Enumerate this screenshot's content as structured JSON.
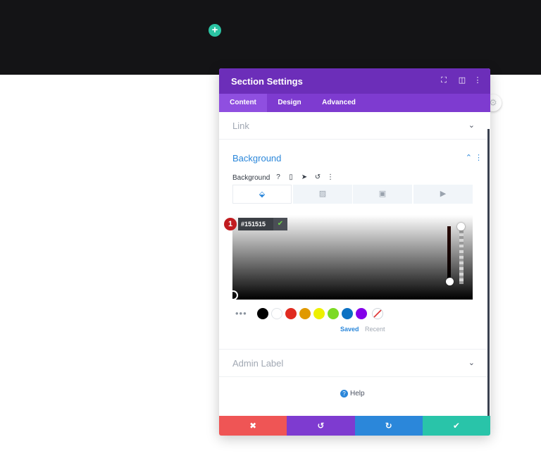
{
  "canvas": {
    "add_section_icon": "plus-icon",
    "add_symbol": "+",
    "side_handle_icon": "gear-icon",
    "side_handle_symbol": "⚙"
  },
  "modal": {
    "title": "Section Settings",
    "header_icons": [
      {
        "name": "expand-icon",
        "glyph": "⛶"
      },
      {
        "name": "split-view-icon",
        "glyph": "◫"
      },
      {
        "name": "more-vertical-icon",
        "glyph": "⋮"
      }
    ],
    "tabs": [
      {
        "label": "Content",
        "active": true
      },
      {
        "label": "Design",
        "active": false
      },
      {
        "label": "Advanced",
        "active": false
      }
    ]
  },
  "sections": {
    "link": {
      "title": "Link",
      "chevron": "⌄"
    },
    "background": {
      "title": "Background",
      "chevron": "⌃",
      "dots": "⋮",
      "field_label": "Background",
      "field_icons": [
        {
          "name": "help-icon",
          "glyph": "?"
        },
        {
          "name": "mobile-icon",
          "glyph": "▯"
        },
        {
          "name": "hover-cursor-icon",
          "glyph": "➤"
        },
        {
          "name": "reset-icon",
          "glyph": "↺"
        },
        {
          "name": "more-icon",
          "glyph": "⋮"
        }
      ],
      "type_tabs": [
        {
          "name": "color-fill-icon",
          "glyph": "⬙",
          "active": true
        },
        {
          "name": "gradient-icon",
          "glyph": "▨",
          "active": false
        },
        {
          "name": "image-icon",
          "glyph": "▣",
          "active": false
        },
        {
          "name": "video-icon",
          "glyph": "▶",
          "active": false
        }
      ],
      "color_hex": "#151515",
      "confirm_glyph": "✔",
      "marker_number": "1",
      "swatches": [
        "#000000",
        "#ffffff",
        "#e02b20",
        "#e09900",
        "#edf000",
        "#7cda24",
        "#0c71c3",
        "#8300e9"
      ],
      "more_glyph": "•••",
      "saved_label": "Saved",
      "recent_label": "Recent"
    },
    "admin_label": {
      "title": "Admin Label",
      "chevron": "⌄"
    }
  },
  "help": {
    "label": "Help",
    "glyph": "?"
  },
  "footer": {
    "buttons": [
      {
        "name": "cancel-button",
        "glyph": "✖",
        "color": "#ef5555"
      },
      {
        "name": "undo-button",
        "glyph": "↺",
        "color": "#7e3bd0"
      },
      {
        "name": "redo-button",
        "glyph": "↻",
        "color": "#2b87da"
      },
      {
        "name": "save-button",
        "glyph": "✔",
        "color": "#29c4a9"
      }
    ]
  },
  "colors": {
    "header": "#6c2eb9",
    "tabs": "#7e3bd0",
    "accent": "#2b87da",
    "teal": "#2bc4a3"
  }
}
